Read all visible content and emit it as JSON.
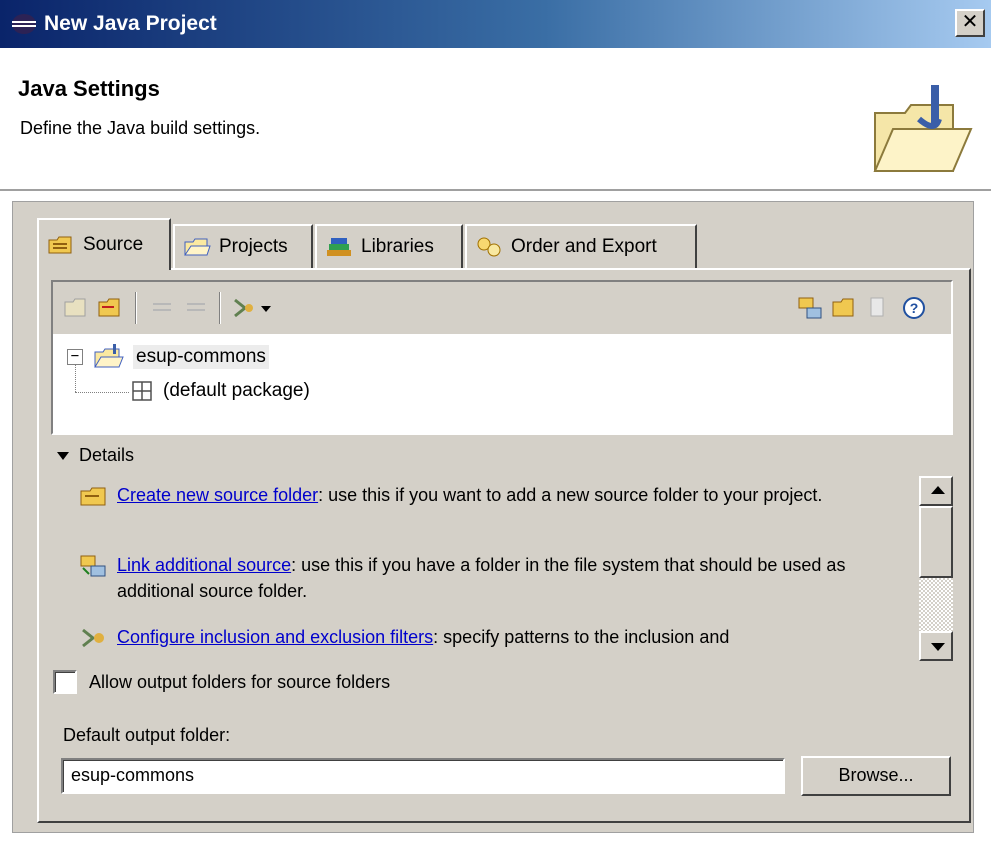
{
  "window": {
    "title": "New Java Project",
    "close_glyph": "✕"
  },
  "header": {
    "title": "Java Settings",
    "description": "Define the Java build settings."
  },
  "tabs": [
    {
      "label": "Source",
      "icon": "source-folder-icon",
      "active": true
    },
    {
      "label": "Projects",
      "icon": "projects-icon",
      "active": false
    },
    {
      "label": "Libraries",
      "icon": "libraries-icon",
      "active": false
    },
    {
      "label": "Order and Export",
      "icon": "order-export-icon",
      "active": false
    }
  ],
  "tree": {
    "root": {
      "label": "esup-commons",
      "expander": "−"
    },
    "child": {
      "label": "(default package)"
    }
  },
  "details": {
    "toggle_label": "Details",
    "items": [
      {
        "link": "Create new source folder",
        "text": ": use this if you want to add a new source folder to your project.",
        "icon": "new-source-folder-icon"
      },
      {
        "link": "Link additional source",
        "text": ": use this if you have a folder in the file system that should be used as additional source folder.",
        "icon": "link-source-icon"
      },
      {
        "link": "Configure inclusion and exclusion filters",
        "text": ": specify patterns to the inclusion and",
        "icon": "filter-icon"
      }
    ]
  },
  "options": {
    "allow_output_label": "Allow output folders for source folders",
    "allow_output_checked": false
  },
  "output": {
    "label": "Default output folder:",
    "value": "esup-commons",
    "browse_label": "Browse..."
  },
  "colors": {
    "titlebar_start": "#0a246a",
    "titlebar_end": "#a6caf0",
    "dialog_bg": "#d4d0c8",
    "link": "#0000cc"
  }
}
